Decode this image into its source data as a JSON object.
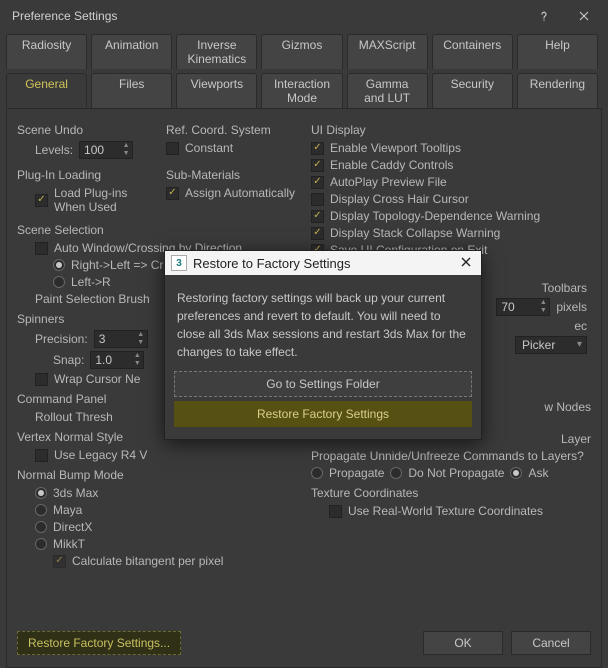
{
  "window": {
    "title": "Preference Settings"
  },
  "tabs_row1": [
    "Radiosity",
    "Animation",
    "Inverse Kinematics",
    "Gizmos",
    "MAXScript",
    "Containers",
    "Help"
  ],
  "tabs_row2": [
    "General",
    "Files",
    "Viewports",
    "Interaction Mode",
    "Gamma and LUT",
    "Security",
    "Rendering"
  ],
  "active_tab": "General",
  "left": {
    "scene_undo": "Scene Undo",
    "levels_label": "Levels:",
    "levels_value": "100",
    "plugin_loading": "Plug-In Loading",
    "load_plugins": "Load Plug-ins When Used",
    "scene_selection": "Scene Selection",
    "auto_window": "Auto Window/Crossing by Direction",
    "rl_crossing": "Right->Left => Crossing",
    "lr_crossing": "Left->R",
    "paint_brush": "Paint Selection Brush",
    "spinners": "Spinners",
    "precision_label": "Precision:",
    "precision_value": "3",
    "snap_label": "Snap:",
    "snap_value": "1.0",
    "wrap_cursor": "Wrap Cursor Ne",
    "command_panel": "Command Panel",
    "rollout_thresh": "Rollout Thresh",
    "vertex_normal": "Vertex Normal Style",
    "use_legacy": "Use Legacy R4 V",
    "bump_mode": "Normal Bump Mode",
    "bm_3dsmax": "3ds Max",
    "bm_maya": "Maya",
    "bm_directx": "DirectX",
    "bm_mikkt": "MikkT",
    "calc_bitangent": "Calculate bitangent per pixel"
  },
  "mid": {
    "ref_coord": "Ref. Coord. System",
    "constant": "Constant",
    "submaterials": "Sub-Materials",
    "assign_auto": "Assign Automatically"
  },
  "right": {
    "ui_display": "UI Display",
    "r1": "Enable Viewport Tooltips",
    "r2": "Enable Caddy Controls",
    "r3": "AutoPlay Preview File",
    "r4": "Display Cross Hair Cursor",
    "r5": "Display Topology-Dependence Warning",
    "r6": "Display Stack Collapse Warning",
    "r7": "Save UI Configuration on Exit",
    "toolbars": "Toolbars",
    "toolbar_value": "70",
    "pixels": "pixels",
    "sec_label": "ec",
    "picker_value": "Picker",
    "layers": "Layer",
    "nodes": "w Nodes",
    "propagate_text": "Propagate Unnide/Unfreeze Commands to Layers?",
    "p1": "Propagate",
    "p2": "Do Not Propagate",
    "p3": "Ask",
    "tex_coords": "Texture Coordinates",
    "use_real_world": "Use Real-World Texture Coordinates"
  },
  "footer": {
    "restore": "Restore Factory Settings...",
    "ok": "OK",
    "cancel": "Cancel"
  },
  "modal": {
    "title": "Restore to Factory Settings",
    "body": "Restoring factory settings will back up your current preferences and revert to default. You will need to close all 3ds Max sessions and restart 3ds Max for the changes to take effect.",
    "btn1": "Go to Settings Folder",
    "btn2": "Restore Factory Settings"
  }
}
